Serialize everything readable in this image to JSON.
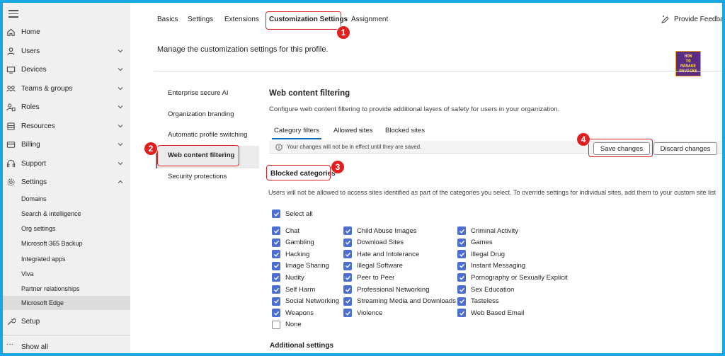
{
  "sidebar": {
    "items": [
      {
        "label": "Home",
        "icon": "home-icon",
        "chevron": false
      },
      {
        "label": "Users",
        "icon": "user-icon",
        "chevron": "down"
      },
      {
        "label": "Devices",
        "icon": "devices-icon",
        "chevron": "down"
      },
      {
        "label": "Teams & groups",
        "icon": "teams-icon",
        "chevron": "down"
      },
      {
        "label": "Roles",
        "icon": "roles-icon",
        "chevron": "down"
      },
      {
        "label": "Resources",
        "icon": "resources-icon",
        "chevron": "down"
      },
      {
        "label": "Billing",
        "icon": "billing-icon",
        "chevron": "down"
      },
      {
        "label": "Support",
        "icon": "support-icon",
        "chevron": "down"
      },
      {
        "label": "Settings",
        "icon": "gear-icon",
        "chevron": "up"
      }
    ],
    "settings_sub": [
      "Domains",
      "Search & intelligence",
      "Org settings",
      "Microsoft 365 Backup",
      "Integrated apps",
      "Viva",
      "Partner relationships",
      "Microsoft Edge"
    ],
    "selected_sub": "Microsoft Edge",
    "setup": "Setup",
    "show_all": "Show all"
  },
  "tabs": [
    "Basics",
    "Settings",
    "Extensions",
    "Customization Settings",
    "Assignment"
  ],
  "active_tab": "Customization Settings",
  "feedback": "Provide Feedback",
  "subtitle": "Manage the customization settings for this profile.",
  "logo": {
    "line1": "HOW",
    "line2": "TO",
    "line3": "MANAGE",
    "line4": "DEVICES"
  },
  "left_nav": [
    "Enterprise secure AI",
    "Organization branding",
    "Automatic profile switching",
    "Web content filtering",
    "Security protections"
  ],
  "selected_nav": "Web content filtering",
  "panel": {
    "title": "Web content filtering",
    "description": "Configure web content filtering to provide additional layers of safety for users in your organization.",
    "subtabs": [
      "Category filters",
      "Allowed sites",
      "Blocked sites"
    ],
    "info": "Your changes will not be in effect until they are saved.",
    "save": "Save changes",
    "discard": "Discard changes",
    "blocked_title": "Blocked categories",
    "blocked_desc": "Users will not be allowed to access sites identified as part of the categories you select. To override settings for individual sites, add them to your custom site list",
    "select_all": "Select all",
    "col1": [
      "Chat",
      "Gambling",
      "Hacking",
      "Image Sharing",
      "Nudity",
      "Self Harm",
      "Social Networking",
      "Weapons",
      "None"
    ],
    "col2": [
      "Child Abuse Images",
      "Download Sites",
      "Hate and Intolerance",
      "Illegal Software",
      "Peer to Peer",
      "Professional Networking",
      "Streaming Media and Downloads",
      "Violence"
    ],
    "col3": [
      "Criminal Activity",
      "Games",
      "Illegal Drug",
      "Instant Messaging",
      "Pornography or Sexually Explicit",
      "Sex Education",
      "Tasteless",
      "Web Based Email"
    ],
    "unchecked": [
      "None"
    ],
    "additional": "Additional settings"
  },
  "badges": [
    "1",
    "2",
    "3",
    "4"
  ],
  "colors": {
    "accent": "#0f6cbd",
    "checkbox": "#4d6ed1",
    "callout": "#e02020",
    "frame": "#1aa7e6"
  }
}
